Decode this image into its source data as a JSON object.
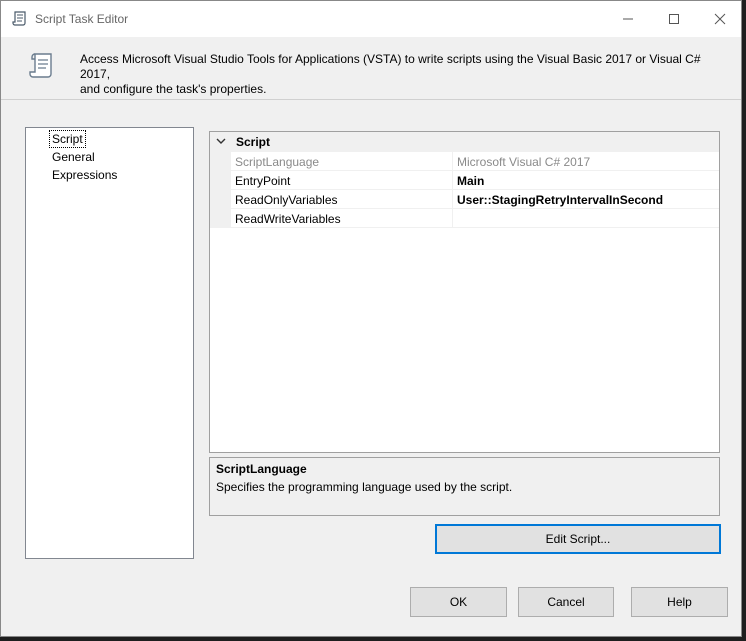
{
  "window": {
    "title": "Script Task Editor",
    "title_icon": "script-scroll-icon",
    "controls": {
      "minimize": "minimize-icon",
      "maximize": "maximize-icon",
      "close": "close-icon"
    }
  },
  "header": {
    "icon": "script-scroll-icon",
    "description_line1": "Access Microsoft Visual Studio Tools for Applications (VSTA) to write scripts using the Visual Basic 2017 or Visual C# 2017,",
    "description_line2": "and configure the task's properties."
  },
  "nav": {
    "items": [
      {
        "label": "Script",
        "selected": true
      },
      {
        "label": "General",
        "selected": false
      },
      {
        "label": "Expressions",
        "selected": false
      }
    ]
  },
  "grid": {
    "category": "Script",
    "properties": [
      {
        "name": "ScriptLanguage",
        "value": "Microsoft Visual C# 2017",
        "disabled": true,
        "bold": false
      },
      {
        "name": "EntryPoint",
        "value": "Main",
        "disabled": false,
        "bold": true
      },
      {
        "name": "ReadOnlyVariables",
        "value": "User::StagingRetryIntervalInSecond",
        "disabled": false,
        "bold": true
      },
      {
        "name": "ReadWriteVariables",
        "value": "",
        "disabled": false,
        "bold": false
      }
    ]
  },
  "description": {
    "title": "ScriptLanguage",
    "text": "Specifies the programming language used by the script."
  },
  "buttons": {
    "edit_script": "Edit Script...",
    "ok": "OK",
    "cancel": "Cancel",
    "help": "Help"
  },
  "colors": {
    "accent_focus": "#0078d7",
    "window_bg": "#f0f0f0"
  }
}
